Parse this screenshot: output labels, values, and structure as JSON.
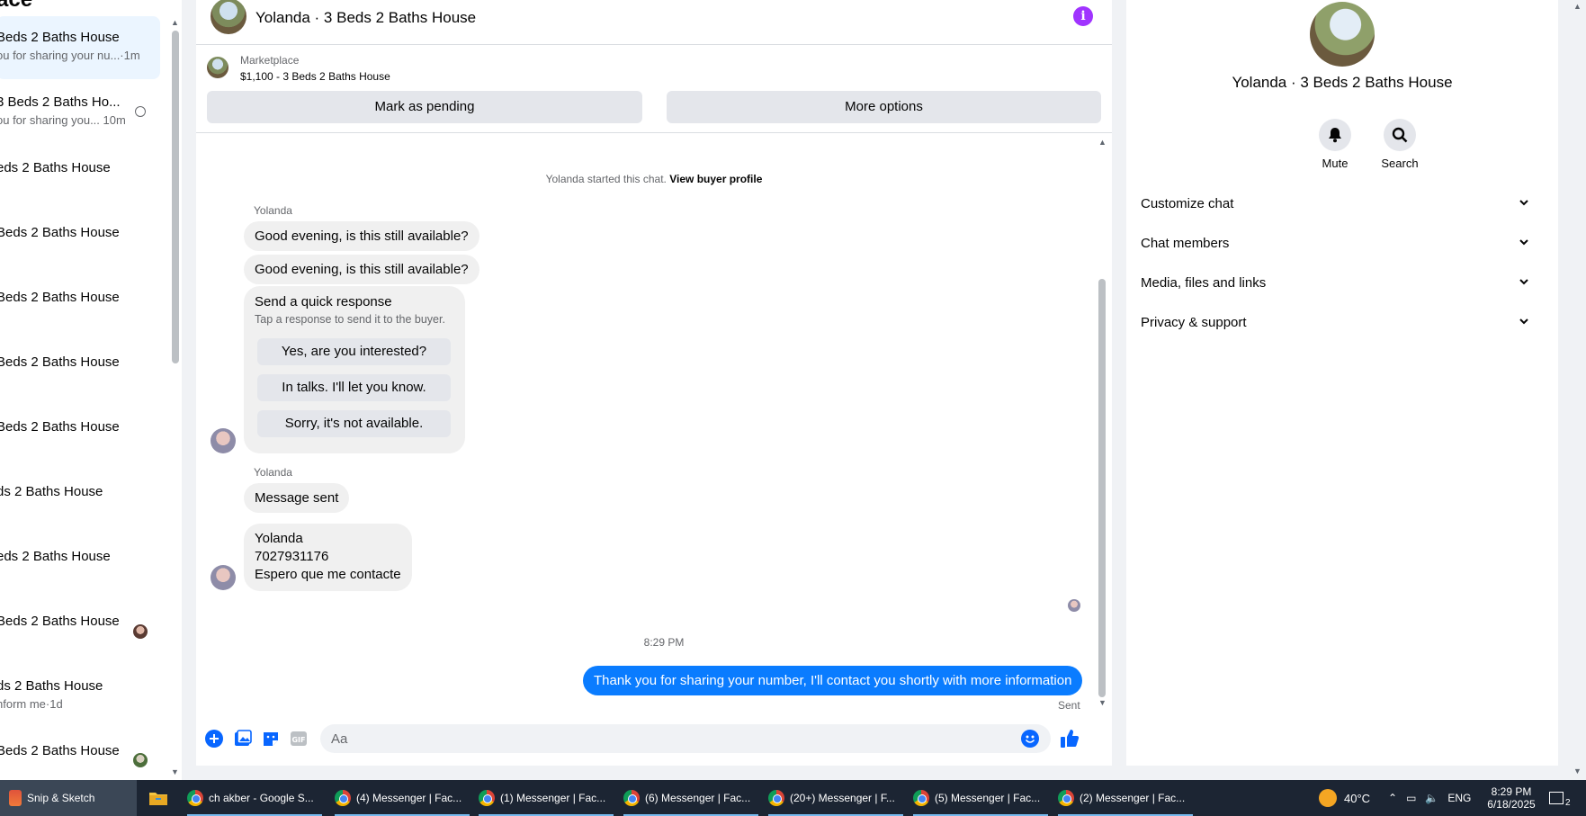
{
  "left_panel": {
    "heading": "ace",
    "conversations": [
      {
        "title": "Beds 2 Baths House",
        "snippet": "ou for sharing your nu...·1m",
        "active": true
      },
      {
        "title": "3 Beds 2 Baths Ho...",
        "snippet": "ou for sharing you... 10m"
      },
      {
        "title": "eds 2 Baths House",
        "snippet": ""
      },
      {
        "title": "Beds 2 Baths House",
        "snippet": ""
      },
      {
        "title": "Beds 2 Baths House",
        "snippet": ""
      },
      {
        "title": "Beds 2 Baths House",
        "snippet": ""
      },
      {
        "title": "Beds 2 Baths House",
        "snippet": ""
      },
      {
        "title": "ds 2 Baths House",
        "snippet": ""
      },
      {
        "title": "eds 2 Baths House",
        "snippet": ""
      },
      {
        "title": "Beds 2 Baths House",
        "snippet": ""
      },
      {
        "title": "ds 2 Baths House",
        "snippet": "nform me·1d"
      },
      {
        "title": "Beds 2 Baths House",
        "snippet": ""
      }
    ]
  },
  "chat": {
    "title": "Yolanda · 3 Beds 2 Baths House",
    "marketplace_label": "Marketplace",
    "listing": "$1,100 - 3 Beds 2 Baths House",
    "mark_pending": "Mark as pending",
    "more_options": "More options",
    "started_text": "Yolanda started this chat.",
    "view_profile": "View buyer profile",
    "sender_name": "Yolanda",
    "message_1": "Good evening, is this still available?",
    "message_2": "Good evening, is this still available?",
    "quick_title": "Send a quick response",
    "quick_sub": "Tap a response to send it to the buyer.",
    "quick_1": "Yes, are you interested?",
    "quick_2": "In talks. I'll let you know.",
    "quick_3": "Sorry, it's not available.",
    "message_sent": "Message sent",
    "contact_line_1": "Yolanda",
    "contact_line_2": "7027931176",
    "contact_line_3": "Espero que me contacte",
    "timestamp": "8:29 PM",
    "outgoing": "Thank you for sharing your number, I'll contact you shortly with more information",
    "status": "Sent",
    "input_placeholder": "Aa"
  },
  "info_panel": {
    "title": "Yolanda · 3 Beds 2 Baths House",
    "mute": "Mute",
    "search": "Search",
    "sections": [
      "Customize chat",
      "Chat members",
      "Media, files and links",
      "Privacy & support"
    ]
  },
  "taskbar": {
    "snip": "Snip & Sketch",
    "apps": [
      "ch akber - Google S...",
      "(4) Messenger | Fac...",
      "(1) Messenger | Fac...",
      "(6) Messenger | Fac...",
      "(20+) Messenger | F...",
      "(5) Messenger | Fac...",
      "(2) Messenger | Fac..."
    ],
    "temperature": "40°C",
    "language": "ENG",
    "time": "8:29 PM",
    "date": "6/18/2025",
    "notifications": "2"
  },
  "colors": {
    "accent": "#0a7cff",
    "info": "#a033ff",
    "icon_blue": "#0866ff"
  }
}
